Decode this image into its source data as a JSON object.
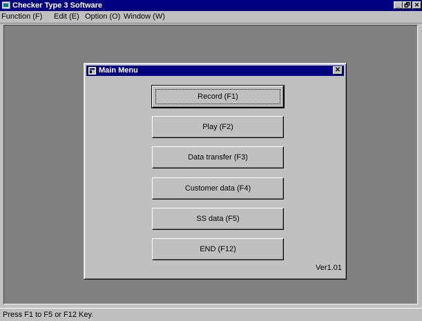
{
  "app": {
    "title": "Checker Type 3 Software",
    "icon": "app-icon",
    "window_buttons": {
      "minimize": "_",
      "maximize": "🗗",
      "close": "✕"
    }
  },
  "menubar": {
    "items": [
      {
        "label": "Function (F)"
      },
      {
        "label": "Edit (E)"
      },
      {
        "label": "Option (O)"
      },
      {
        "label": "Window (W)"
      }
    ]
  },
  "dialog": {
    "title": "Main Menu",
    "close_glyph": "✕",
    "buttons": [
      {
        "label": "Record (F1)",
        "default": true
      },
      {
        "label": "Play (F2)"
      },
      {
        "label": "Data transfer (F3)"
      },
      {
        "label": "Customer data (F4)"
      },
      {
        "label": "SS data (F5)"
      },
      {
        "label": "END (F12)"
      }
    ],
    "version": "Ver1.01"
  },
  "statusbar": {
    "text": "Press F1 to F5 or F12 Key."
  },
  "colors": {
    "titlebar": "#000080",
    "face": "#c0c0c0",
    "workspace": "#808080"
  }
}
